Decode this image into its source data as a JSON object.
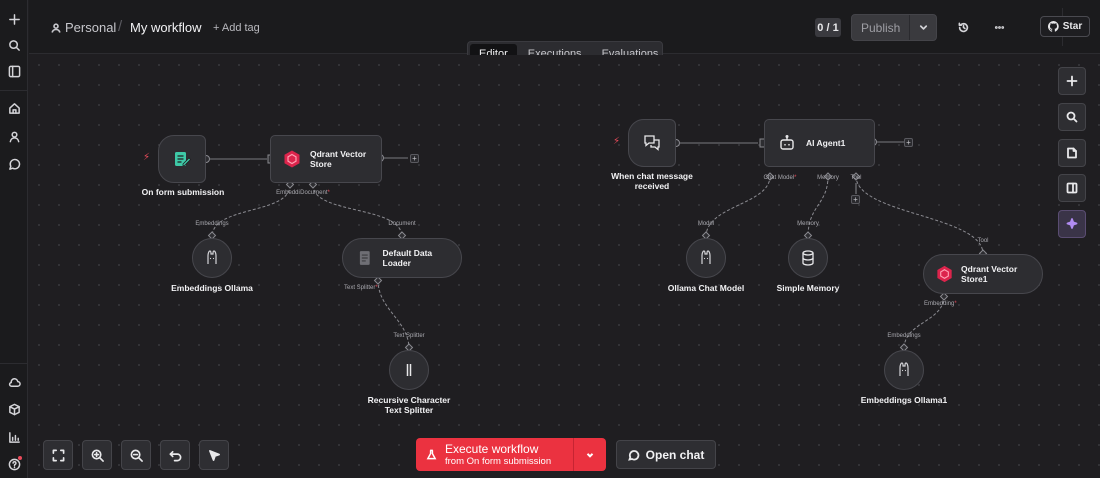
{
  "breadcrumb": {
    "project": "Personal",
    "separator": "/",
    "workflow_name": "My workflow",
    "add_tag": "+ Add tag"
  },
  "header": {
    "counter": "0 / 1",
    "publish": "Publish",
    "star": "Star"
  },
  "tabs": [
    "Editor",
    "Executions",
    "Evaluations"
  ],
  "nodes": {
    "form_trigger": {
      "label": "On form submission"
    },
    "qdrant": {
      "label_line1": "Qdrant Vector",
      "label_line2": "Store",
      "port1": "Embeddi",
      "port2": "Document",
      "port2_req": "*"
    },
    "embeddings": {
      "label": "Embeddings Ollama",
      "port_in": "Embeddings"
    },
    "loader": {
      "label": "Default Data Loader",
      "port_in": "Document",
      "port_out": "Text Splitter",
      "port_out_req": "*"
    },
    "splitter": {
      "label_line1": "Recursive Character",
      "label_line2": "Text Splitter",
      "port_in": "Text Splitter"
    },
    "chat_trigger": {
      "label_line1": "When chat message",
      "label_line2": "received"
    },
    "agent": {
      "label": "AI Agent1",
      "port1": "Chat Model",
      "port1_req": "*",
      "port2": "Memory",
      "port3": "Tool"
    },
    "chat_model": {
      "label": "Ollama Chat Model",
      "port_in": "Model"
    },
    "memory": {
      "label": "Simple Memory",
      "port_in": "Memory"
    },
    "qdrant2": {
      "label": "Qdrant Vector Store1",
      "port_in": "Tool",
      "port_out": "Embedding",
      "port_out_req": "*"
    },
    "embeddings2": {
      "label": "Embeddings Ollama1",
      "port_in": "Embeddings"
    }
  },
  "bottom": {
    "execute_line1": "Execute workflow",
    "execute_line2": "from On form submission",
    "open_chat": "Open chat"
  },
  "colors": {
    "accent": "#eb3240",
    "qdrant": "#dc244c",
    "trigger_icon": "#3ec9a7",
    "canvas": "#1f1e21"
  },
  "icons": {
    "rail": [
      "plus-icon",
      "search-icon",
      "panel-icon",
      "home-icon",
      "user-icon",
      "chat-icon",
      "cloud-icon",
      "box-icon",
      "chart-icon",
      "help-icon"
    ],
    "right_toolbar": [
      "zoom-plus-icon",
      "search-icon",
      "note-icon",
      "panel-icon",
      "ai-sparkle-icon"
    ],
    "bottom_toolbar": [
      "fit-view-icon",
      "zoom-in-icon",
      "zoom-out-icon",
      "undo-icon",
      "pointer-icon"
    ]
  }
}
